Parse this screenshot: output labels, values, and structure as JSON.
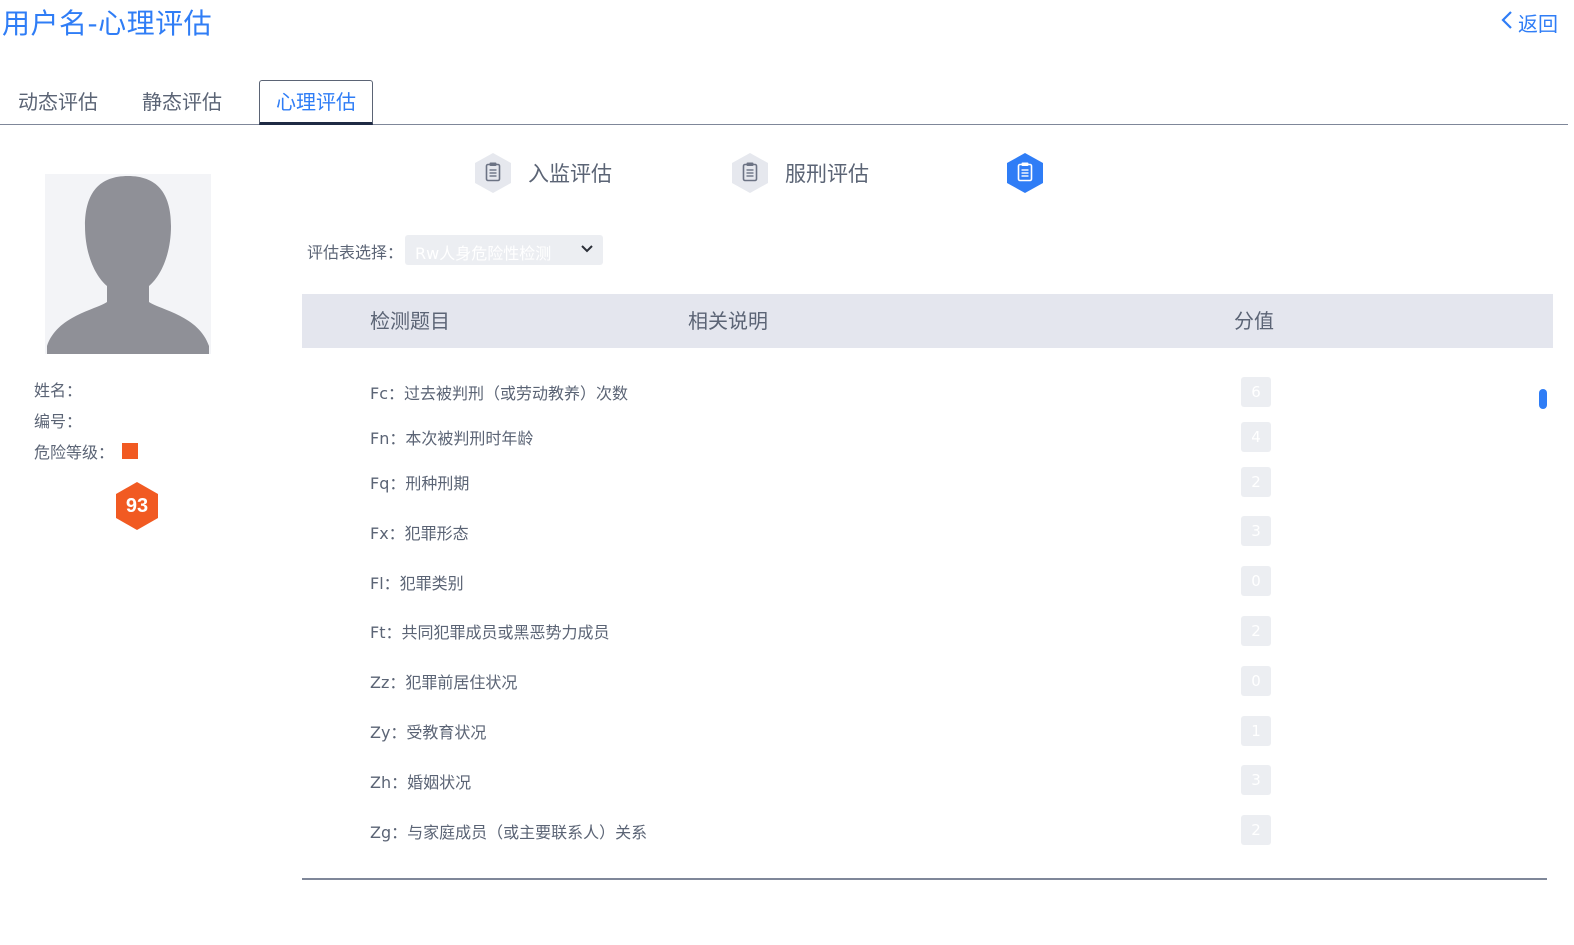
{
  "header": {
    "title": "用户名-心理评估",
    "back_label": "返回"
  },
  "tabs": [
    {
      "label": "动态评估",
      "active": false
    },
    {
      "label": "静态评估",
      "active": false
    },
    {
      "label": "心理评估",
      "active": true
    }
  ],
  "profile": {
    "name_label": "姓名：",
    "id_label": "编号：",
    "risk_label": "危险等级：",
    "risk_color": "#f15a22",
    "score": "93"
  },
  "subtypes": [
    {
      "label": "入监评估",
      "icon": "clipboard-icon",
      "active": false
    },
    {
      "label": "服刑评估",
      "icon": "clipboard-icon",
      "active": false
    },
    {
      "label": "",
      "icon": "clipboard-icon",
      "active": true
    }
  ],
  "selector": {
    "label": "评估表选择：",
    "value": "Rw人身危险性检测"
  },
  "table": {
    "headers": [
      "检测题目",
      "相关说明",
      "分值"
    ],
    "rows": [
      {
        "label": "Fc：过去被判刑（或劳动教养）次数",
        "score": "6"
      },
      {
        "label": "Fn：本次被判刑时年龄",
        "score": "4"
      },
      {
        "label": "Fq：刑种刑期",
        "score": "2"
      },
      {
        "label": "Fx：犯罪形态",
        "score": "3"
      },
      {
        "label": "Fl：犯罪类别",
        "score": "0"
      },
      {
        "label": "Ft：共同犯罪成员或黑恶势力成员",
        "score": "2"
      },
      {
        "label": "Zz：犯罪前居住状况",
        "score": "0"
      },
      {
        "label": "Zy：受教育状况",
        "score": "1"
      },
      {
        "label": "Zh：婚姻状况",
        "score": "3"
      },
      {
        "label": "Zg：与家庭成员（或主要联系人）关系",
        "score": "2"
      }
    ]
  },
  "colors": {
    "accent": "#2f7df6",
    "danger": "#f15a22",
    "header_bg": "#e4e6ee"
  }
}
